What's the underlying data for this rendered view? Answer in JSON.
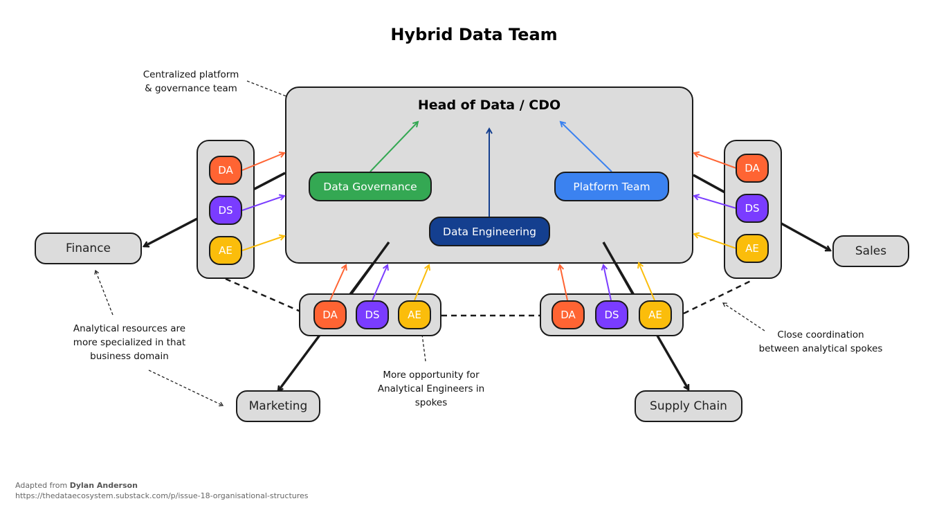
{
  "title": "Hybrid Data Team",
  "hub": {
    "title": "Head of Data / CDO",
    "teams": [
      {
        "label": "Data Governance",
        "color": "#34a853"
      },
      {
        "label": "Data Engineering",
        "color": "#143f8f"
      },
      {
        "label": "Platform Team",
        "color": "#3b82f0"
      }
    ]
  },
  "roles": {
    "da": {
      "label": "DA",
      "color": "#ff6433"
    },
    "ds": {
      "label": "DS",
      "color": "#7a3cff"
    },
    "ae": {
      "label": "AE",
      "color": "#fbbd0b"
    }
  },
  "domains": {
    "finance": "Finance",
    "sales": "Sales",
    "marketing": "Marketing",
    "supply_chain": "Supply Chain"
  },
  "annotations": {
    "centralized": [
      "Centralized platform",
      "& governance team"
    ],
    "specialized": [
      "Analytical resources are",
      "more specialized in that",
      "business domain"
    ],
    "opportunity": [
      "More opportunity for",
      "Analytical Engineers in",
      "spokes"
    ],
    "coordination": [
      "Close coordination",
      "between analytical spokes"
    ]
  },
  "footer": {
    "prefix": "Adapted from ",
    "author": "Dylan Anderson",
    "url": "https://thedataecosystem.substack.com/p/issue-18-organisational-structures"
  }
}
